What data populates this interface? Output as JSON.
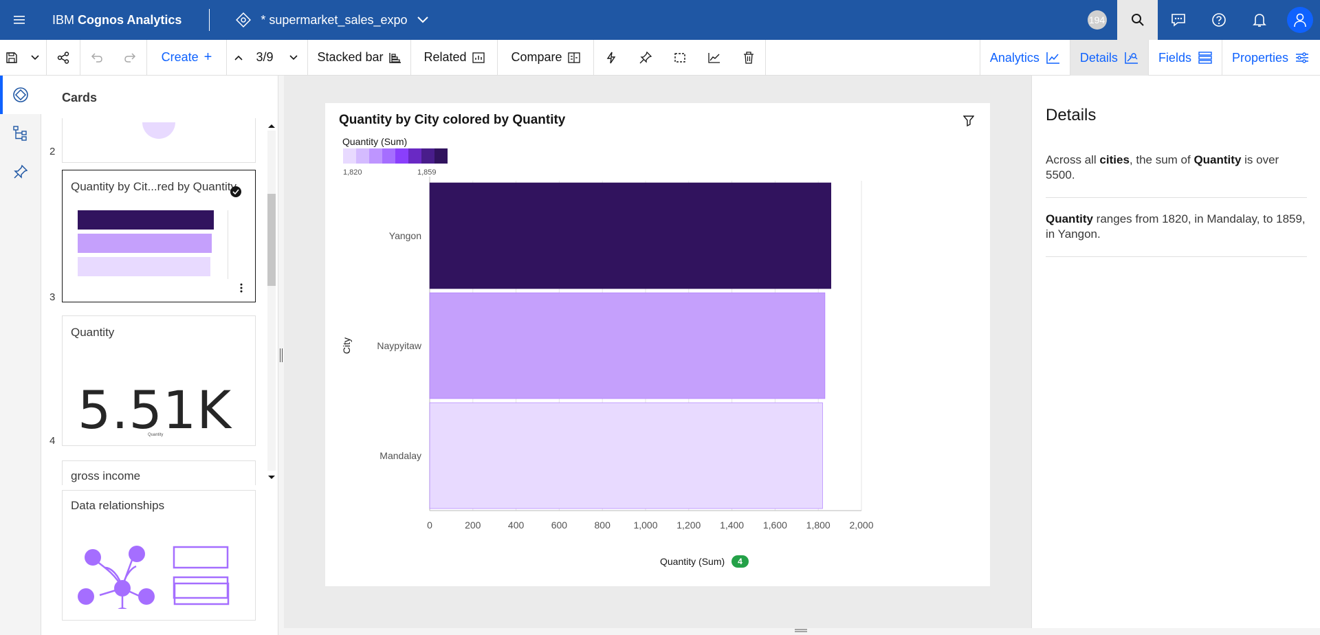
{
  "app": {
    "brand_prefix": "IBM",
    "brand_name": "Cognos Analytics",
    "document_title": "* supermarket_sales_expo",
    "user_badge": "194"
  },
  "toolbar": {
    "create_label": "Create",
    "page_indicator": "3/9",
    "viz_type_label": "Stacked bar",
    "related_label": "Related",
    "compare_label": "Compare",
    "right_tabs": [
      {
        "label": "Analytics",
        "icon": "analytics-icon"
      },
      {
        "label": "Details",
        "icon": "details-icon",
        "active": true
      },
      {
        "label": "Fields",
        "icon": "fields-icon"
      },
      {
        "label": "Properties",
        "icon": "properties-icon"
      }
    ]
  },
  "cards_panel": {
    "title": "Cards",
    "cards": [
      {
        "number": "2"
      },
      {
        "number": "3",
        "title": "Quantity by Cit...red by Quantity"
      },
      {
        "number": "4",
        "title": "Quantity",
        "big_value": "5.51K",
        "caption": "Quantity"
      },
      {
        "title": "gross income"
      },
      {
        "title": "Data relationships"
      }
    ]
  },
  "chart_card": {
    "title": "Quantity by City colored by Quantity",
    "legend_title": "Quantity (Sum)",
    "legend_min": "1,820",
    "legend_max": "1,859",
    "x_title_badge": "4"
  },
  "chart_data": {
    "type": "bar",
    "orientation": "horizontal",
    "title": "Quantity by City colored by Quantity",
    "xlabel": "Quantity (Sum)",
    "ylabel": "City",
    "categories": [
      "Yangon",
      "Naypyitaw",
      "Mandalay"
    ],
    "values": [
      1859,
      1831,
      1820
    ],
    "colors": [
      "#31135e",
      "#c5a0fc",
      "#e8daff"
    ],
    "xlim": [
      0,
      2000
    ],
    "xticks": [
      "0",
      "200",
      "400",
      "600",
      "800",
      "1,000",
      "1,200",
      "1,400",
      "1,600",
      "1,800",
      "2,000"
    ],
    "grid": true,
    "legend_colors": [
      "#e8daff",
      "#d4bbff",
      "#be95ff",
      "#a56eff",
      "#8a3ffc",
      "#6929c4",
      "#491d8b",
      "#31135e"
    ]
  },
  "details_panel": {
    "title": "Details",
    "insight1_a": "Across all ",
    "insight1_b": "cities",
    "insight1_c": ", the sum of ",
    "insight1_d": "Quantity",
    "insight1_e": " is over 5500.",
    "insight2_a": "Quantity",
    "insight2_b": " ranges from 1820, in Mandalay, to 1859, in Yangon."
  }
}
